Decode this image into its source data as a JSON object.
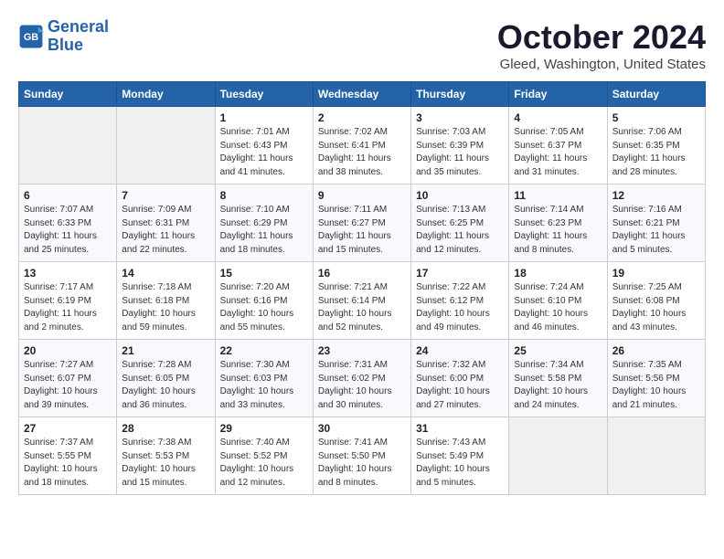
{
  "header": {
    "logo_line1": "General",
    "logo_line2": "Blue",
    "month": "October 2024",
    "location": "Gleed, Washington, United States"
  },
  "weekdays": [
    "Sunday",
    "Monday",
    "Tuesday",
    "Wednesday",
    "Thursday",
    "Friday",
    "Saturday"
  ],
  "weeks": [
    [
      {
        "day": "",
        "sunrise": "",
        "sunset": "",
        "daylight": ""
      },
      {
        "day": "",
        "sunrise": "",
        "sunset": "",
        "daylight": ""
      },
      {
        "day": "1",
        "sunrise": "Sunrise: 7:01 AM",
        "sunset": "Sunset: 6:43 PM",
        "daylight": "Daylight: 11 hours and 41 minutes."
      },
      {
        "day": "2",
        "sunrise": "Sunrise: 7:02 AM",
        "sunset": "Sunset: 6:41 PM",
        "daylight": "Daylight: 11 hours and 38 minutes."
      },
      {
        "day": "3",
        "sunrise": "Sunrise: 7:03 AM",
        "sunset": "Sunset: 6:39 PM",
        "daylight": "Daylight: 11 hours and 35 minutes."
      },
      {
        "day": "4",
        "sunrise": "Sunrise: 7:05 AM",
        "sunset": "Sunset: 6:37 PM",
        "daylight": "Daylight: 11 hours and 31 minutes."
      },
      {
        "day": "5",
        "sunrise": "Sunrise: 7:06 AM",
        "sunset": "Sunset: 6:35 PM",
        "daylight": "Daylight: 11 hours and 28 minutes."
      }
    ],
    [
      {
        "day": "6",
        "sunrise": "Sunrise: 7:07 AM",
        "sunset": "Sunset: 6:33 PM",
        "daylight": "Daylight: 11 hours and 25 minutes."
      },
      {
        "day": "7",
        "sunrise": "Sunrise: 7:09 AM",
        "sunset": "Sunset: 6:31 PM",
        "daylight": "Daylight: 11 hours and 22 minutes."
      },
      {
        "day": "8",
        "sunrise": "Sunrise: 7:10 AM",
        "sunset": "Sunset: 6:29 PM",
        "daylight": "Daylight: 11 hours and 18 minutes."
      },
      {
        "day": "9",
        "sunrise": "Sunrise: 7:11 AM",
        "sunset": "Sunset: 6:27 PM",
        "daylight": "Daylight: 11 hours and 15 minutes."
      },
      {
        "day": "10",
        "sunrise": "Sunrise: 7:13 AM",
        "sunset": "Sunset: 6:25 PM",
        "daylight": "Daylight: 11 hours and 12 minutes."
      },
      {
        "day": "11",
        "sunrise": "Sunrise: 7:14 AM",
        "sunset": "Sunset: 6:23 PM",
        "daylight": "Daylight: 11 hours and 8 minutes."
      },
      {
        "day": "12",
        "sunrise": "Sunrise: 7:16 AM",
        "sunset": "Sunset: 6:21 PM",
        "daylight": "Daylight: 11 hours and 5 minutes."
      }
    ],
    [
      {
        "day": "13",
        "sunrise": "Sunrise: 7:17 AM",
        "sunset": "Sunset: 6:19 PM",
        "daylight": "Daylight: 11 hours and 2 minutes."
      },
      {
        "day": "14",
        "sunrise": "Sunrise: 7:18 AM",
        "sunset": "Sunset: 6:18 PM",
        "daylight": "Daylight: 10 hours and 59 minutes."
      },
      {
        "day": "15",
        "sunrise": "Sunrise: 7:20 AM",
        "sunset": "Sunset: 6:16 PM",
        "daylight": "Daylight: 10 hours and 55 minutes."
      },
      {
        "day": "16",
        "sunrise": "Sunrise: 7:21 AM",
        "sunset": "Sunset: 6:14 PM",
        "daylight": "Daylight: 10 hours and 52 minutes."
      },
      {
        "day": "17",
        "sunrise": "Sunrise: 7:22 AM",
        "sunset": "Sunset: 6:12 PM",
        "daylight": "Daylight: 10 hours and 49 minutes."
      },
      {
        "day": "18",
        "sunrise": "Sunrise: 7:24 AM",
        "sunset": "Sunset: 6:10 PM",
        "daylight": "Daylight: 10 hours and 46 minutes."
      },
      {
        "day": "19",
        "sunrise": "Sunrise: 7:25 AM",
        "sunset": "Sunset: 6:08 PM",
        "daylight": "Daylight: 10 hours and 43 minutes."
      }
    ],
    [
      {
        "day": "20",
        "sunrise": "Sunrise: 7:27 AM",
        "sunset": "Sunset: 6:07 PM",
        "daylight": "Daylight: 10 hours and 39 minutes."
      },
      {
        "day": "21",
        "sunrise": "Sunrise: 7:28 AM",
        "sunset": "Sunset: 6:05 PM",
        "daylight": "Daylight: 10 hours and 36 minutes."
      },
      {
        "day": "22",
        "sunrise": "Sunrise: 7:30 AM",
        "sunset": "Sunset: 6:03 PM",
        "daylight": "Daylight: 10 hours and 33 minutes."
      },
      {
        "day": "23",
        "sunrise": "Sunrise: 7:31 AM",
        "sunset": "Sunset: 6:02 PM",
        "daylight": "Daylight: 10 hours and 30 minutes."
      },
      {
        "day": "24",
        "sunrise": "Sunrise: 7:32 AM",
        "sunset": "Sunset: 6:00 PM",
        "daylight": "Daylight: 10 hours and 27 minutes."
      },
      {
        "day": "25",
        "sunrise": "Sunrise: 7:34 AM",
        "sunset": "Sunset: 5:58 PM",
        "daylight": "Daylight: 10 hours and 24 minutes."
      },
      {
        "day": "26",
        "sunrise": "Sunrise: 7:35 AM",
        "sunset": "Sunset: 5:56 PM",
        "daylight": "Daylight: 10 hours and 21 minutes."
      }
    ],
    [
      {
        "day": "27",
        "sunrise": "Sunrise: 7:37 AM",
        "sunset": "Sunset: 5:55 PM",
        "daylight": "Daylight: 10 hours and 18 minutes."
      },
      {
        "day": "28",
        "sunrise": "Sunrise: 7:38 AM",
        "sunset": "Sunset: 5:53 PM",
        "daylight": "Daylight: 10 hours and 15 minutes."
      },
      {
        "day": "29",
        "sunrise": "Sunrise: 7:40 AM",
        "sunset": "Sunset: 5:52 PM",
        "daylight": "Daylight: 10 hours and 12 minutes."
      },
      {
        "day": "30",
        "sunrise": "Sunrise: 7:41 AM",
        "sunset": "Sunset: 5:50 PM",
        "daylight": "Daylight: 10 hours and 8 minutes."
      },
      {
        "day": "31",
        "sunrise": "Sunrise: 7:43 AM",
        "sunset": "Sunset: 5:49 PM",
        "daylight": "Daylight: 10 hours and 5 minutes."
      },
      {
        "day": "",
        "sunrise": "",
        "sunset": "",
        "daylight": ""
      },
      {
        "day": "",
        "sunrise": "",
        "sunset": "",
        "daylight": ""
      }
    ]
  ]
}
